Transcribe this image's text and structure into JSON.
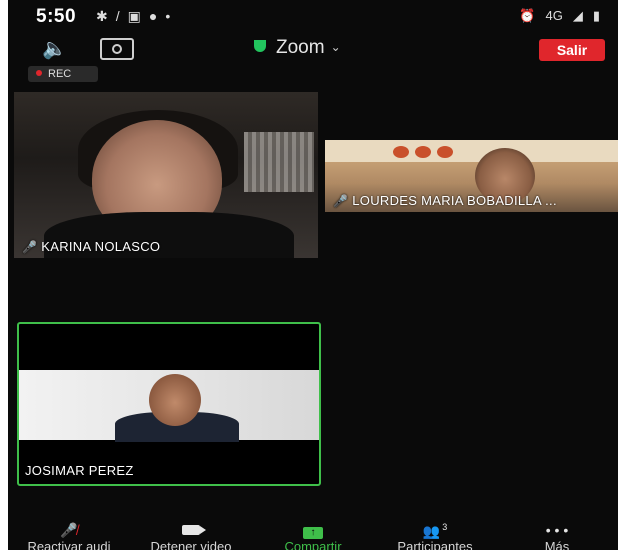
{
  "status_bar": {
    "time": "5:50",
    "left_icons": [
      "signal-icon",
      "alarm-icon",
      "screenshot-icon",
      "whatsapp-icon",
      "dot-icon"
    ],
    "network": "4G"
  },
  "top_bar": {
    "title": "Zoom",
    "leave_label": "Salir",
    "rec_label": "REC"
  },
  "participants": [
    {
      "name": "KARINA NOLASCO",
      "muted": true
    },
    {
      "name": "LOURDES MARIA BOBADILLA ...",
      "muted": true
    },
    {
      "name": "JOSIMAR PEREZ",
      "muted": false,
      "active_speaker": true
    }
  ],
  "toolbar": {
    "items": [
      {
        "label": "Reactivar audi",
        "icon": "mic-off-icon"
      },
      {
        "label": "Detener video",
        "icon": "video-camera-icon"
      },
      {
        "label": "Compartir",
        "icon": "share-screen-icon"
      },
      {
        "label": "Participantes",
        "icon": "participants-icon",
        "count": "3"
      },
      {
        "label": "Más",
        "icon": "more-icon"
      }
    ]
  },
  "colors": {
    "background": "#0a0a0a",
    "leave_red": "#e0262c",
    "active_green": "#3fbf4a",
    "shield_green": "#22c55e"
  }
}
